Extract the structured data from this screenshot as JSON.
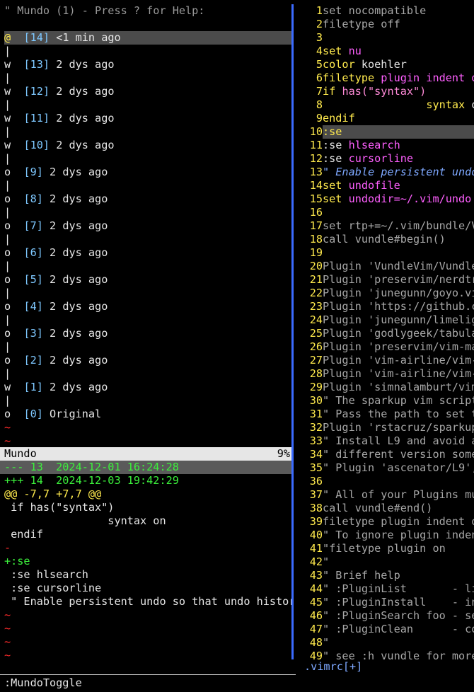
{
  "mundo": {
    "header": "\" Mundo (1) - Press ? for Help:",
    "graph": [
      {
        "mark": "@",
        "node": "[14]",
        "age": "<1 min ago",
        "selected": true
      },
      {
        "mark": "w",
        "node": "[13]",
        "age": "2 dys ago"
      },
      {
        "mark": "w",
        "node": "[12]",
        "age": "2 dys ago"
      },
      {
        "mark": "w",
        "node": "[11]",
        "age": "2 dys ago"
      },
      {
        "mark": "w",
        "node": "[10]",
        "age": "2 dys ago"
      },
      {
        "mark": "o",
        "node": "[9]",
        "age": "2 dys ago"
      },
      {
        "mark": "o",
        "node": "[8]",
        "age": "2 dys ago"
      },
      {
        "mark": "o",
        "node": "[7]",
        "age": "2 dys ago"
      },
      {
        "mark": "o",
        "node": "[6]",
        "age": "2 dys ago"
      },
      {
        "mark": "o",
        "node": "[5]",
        "age": "2 dys ago"
      },
      {
        "mark": "o",
        "node": "[4]",
        "age": "2 dys ago"
      },
      {
        "mark": "o",
        "node": "[3]",
        "age": "2 dys ago"
      },
      {
        "mark": "o",
        "node": "[2]",
        "age": "2 dys ago"
      },
      {
        "mark": "w",
        "node": "[1]",
        "age": "2 dys ago"
      },
      {
        "mark": "o",
        "node": "[0]",
        "age": "Original"
      }
    ],
    "statusline": {
      "name": "Mundo",
      "percent": "9%"
    },
    "diff": {
      "old": "--- 13  2024-12-01 16:24:28",
      "new": "+++ 14  2024-12-03 19:42:29",
      "hunk": "@@ -7,7 +7,7 @@",
      "lines": [
        {
          "type": "ctx",
          "text": " if has(\"syntax\")"
        },
        {
          "type": "ctx",
          "text": "                syntax on"
        },
        {
          "type": "ctx",
          "text": " endif"
        },
        {
          "type": "del",
          "text": "-"
        },
        {
          "type": "add",
          "text": "+:se"
        },
        {
          "type": "ctx",
          "text": " :se hlsearch"
        },
        {
          "type": "ctx",
          "text": " :se cursorline"
        },
        {
          "type": "ctx",
          "text": " \" Enable persistent undo so that undo histor"
        }
      ]
    }
  },
  "editor": {
    "tab_label": ".vimrc[+]",
    "lines": [
      {
        "n": "1",
        "t": "set nocompatible",
        "k": "comment"
      },
      {
        "n": "2",
        "t": "filetype off",
        "k": "comment"
      },
      {
        "n": "3",
        "t": "",
        "k": "plain"
      },
      {
        "n": "4",
        "t": "set nu",
        "k": "setnu"
      },
      {
        "n": "5",
        "t": "color koehler",
        "k": "color"
      },
      {
        "n": "6",
        "t": "filetype plugin indent o",
        "k": "filetype"
      },
      {
        "n": "7",
        "t": "if has(\"syntax\")",
        "k": "if"
      },
      {
        "n": "8",
        "t": "                syntax o",
        "k": "syntax"
      },
      {
        "n": "9",
        "t": "endif",
        "k": "endif"
      },
      {
        "n": "10",
        "t": ":se",
        "k": "cur"
      },
      {
        "n": "11",
        "t": ":se hlsearch",
        "k": "se"
      },
      {
        "n": "12",
        "t": ":se cursorline",
        "k": "se"
      },
      {
        "n": "13",
        "t": "\" Enable persistent undo",
        "k": "bluecomment"
      },
      {
        "n": "14",
        "t": "set undofile",
        "k": "setundo"
      },
      {
        "n": "15",
        "t": "set undodir=~/.vim/undo",
        "k": "setundo"
      },
      {
        "n": "16",
        "t": "",
        "k": "plain"
      },
      {
        "n": "17",
        "t": "set rtp+=~/.vim/bundle/V",
        "k": "comment"
      },
      {
        "n": "18",
        "t": "call vundle#begin()",
        "k": "comment"
      },
      {
        "n": "19",
        "t": "",
        "k": "plain"
      },
      {
        "n": "20",
        "t": "Plugin 'VundleVim/Vundle",
        "k": "comment"
      },
      {
        "n": "21",
        "t": "Plugin 'preservim/nerdtr",
        "k": "comment"
      },
      {
        "n": "22",
        "t": "Plugin 'junegunn/goyo.vi",
        "k": "comment"
      },
      {
        "n": "23",
        "t": "Plugin 'https://github.c",
        "k": "comment"
      },
      {
        "n": "24",
        "t": "Plugin 'junegunn/limelig",
        "k": "comment"
      },
      {
        "n": "25",
        "t": "Plugin 'godlygeek/tabula",
        "k": "comment"
      },
      {
        "n": "26",
        "t": "Plugin 'preservim/vim-ma",
        "k": "comment"
      },
      {
        "n": "27",
        "t": "Plugin 'vim-airline/vim-",
        "k": "comment"
      },
      {
        "n": "28",
        "t": "Plugin 'vim-airline/vim-",
        "k": "comment"
      },
      {
        "n": "29",
        "t": "Plugin 'simnalamburt/vim",
        "k": "comment"
      },
      {
        "n": "30",
        "t": "\" The sparkup vim script",
        "k": "comment"
      },
      {
        "n": "31",
        "t": "\" Pass the path to set t",
        "k": "comment"
      },
      {
        "n": "32",
        "t": "Plugin 'rstacruz/sparkup",
        "k": "comment"
      },
      {
        "n": "33",
        "t": "\" Install L9 and avoid a",
        "k": "comment"
      },
      {
        "n": "34",
        "t": "\" different version some",
        "k": "comment"
      },
      {
        "n": "35",
        "t": "\" Plugin 'ascenator/L9',",
        "k": "comment"
      },
      {
        "n": "36",
        "t": "",
        "k": "plain"
      },
      {
        "n": "37",
        "t": "\" All of your Plugins mu",
        "k": "comment"
      },
      {
        "n": "38",
        "t": "call vundle#end()",
        "k": "comment"
      },
      {
        "n": "39",
        "t": "filetype plugin indent o",
        "k": "comment"
      },
      {
        "n": "40",
        "t": "\" To ignore plugin inden",
        "k": "comment"
      },
      {
        "n": "41",
        "t": "\"filetype plugin on",
        "k": "comment"
      },
      {
        "n": "42",
        "t": "\"",
        "k": "comment"
      },
      {
        "n": "43",
        "t": "\" Brief help",
        "k": "comment"
      },
      {
        "n": "44",
        "t": "\" :PluginList       - li",
        "k": "comment"
      },
      {
        "n": "45",
        "t": "\" :PluginInstall    - in",
        "k": "comment"
      },
      {
        "n": "46",
        "t": "\" :PluginSearch foo - se",
        "k": "comment"
      },
      {
        "n": "47",
        "t": "\" :PluginClean      - co",
        "k": "comment"
      },
      {
        "n": "48",
        "t": "\"",
        "k": "comment"
      },
      {
        "n": "49",
        "t": "\" see :h vundle for more",
        "k": "comment"
      }
    ]
  },
  "command_line": ":MundoToggle"
}
